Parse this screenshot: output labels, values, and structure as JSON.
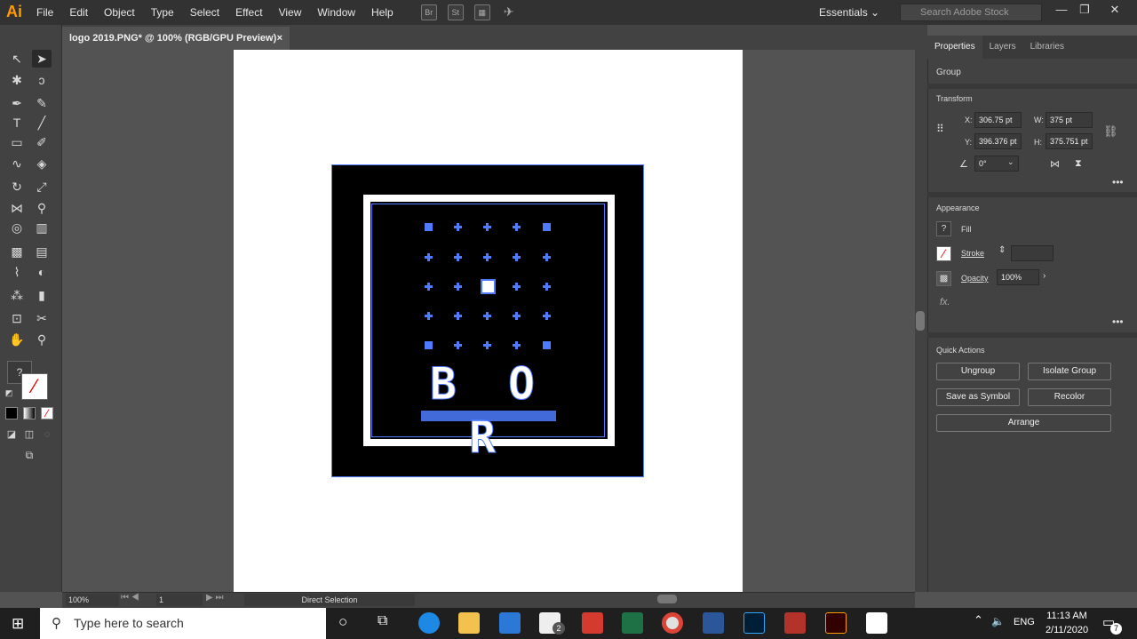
{
  "menubar": {
    "logo": "Ai",
    "items": [
      "File",
      "Edit",
      "Object",
      "Type",
      "Select",
      "Effect",
      "View",
      "Window",
      "Help"
    ],
    "bridge_label": "Br",
    "stock_label": "St",
    "workspace": "Essentials",
    "stock_search_placeholder": "Search Adobe Stock"
  },
  "document": {
    "tab_title": "logo 2019.PNG* @ 100% (RGB/GPU Preview)",
    "close": "×"
  },
  "artwork": {
    "text": "B O R"
  },
  "status": {
    "zoom": "100%",
    "page": "1",
    "tool": "Direct Selection"
  },
  "properties": {
    "tabs": [
      "Properties",
      "Layers",
      "Libraries"
    ],
    "selection_type": "Group",
    "transform_label": "Transform",
    "x_label": "X:",
    "x": "306.75 pt",
    "y_label": "Y:",
    "y": "396.376 pt",
    "w_label": "W:",
    "w": "375 pt",
    "h_label": "H:",
    "h": "375.751 pt",
    "rotate": "0°",
    "appearance_label": "Appearance",
    "fill_label": "Fill",
    "stroke_label": "Stroke",
    "opacity_label": "Opacity",
    "opacity": "100%",
    "fx_label": "fx.",
    "quick_actions_label": "Quick Actions",
    "buttons": {
      "ungroup": "Ungroup",
      "isolate": "Isolate Group",
      "symbol": "Save as Symbol",
      "recolor": "Recolor",
      "arrange": "Arrange"
    }
  },
  "taskbar": {
    "search_placeholder": "Type here to search",
    "lang": "ENG",
    "time": "11:13 AM",
    "date": "2/11/2020",
    "mail_badge": "2",
    "notif_badge": "7"
  },
  "colors": {
    "selection": "#4f7cff",
    "ui_dark": "#323232",
    "panel": "#424242",
    "illustrator_orange": "#ff9a00"
  }
}
